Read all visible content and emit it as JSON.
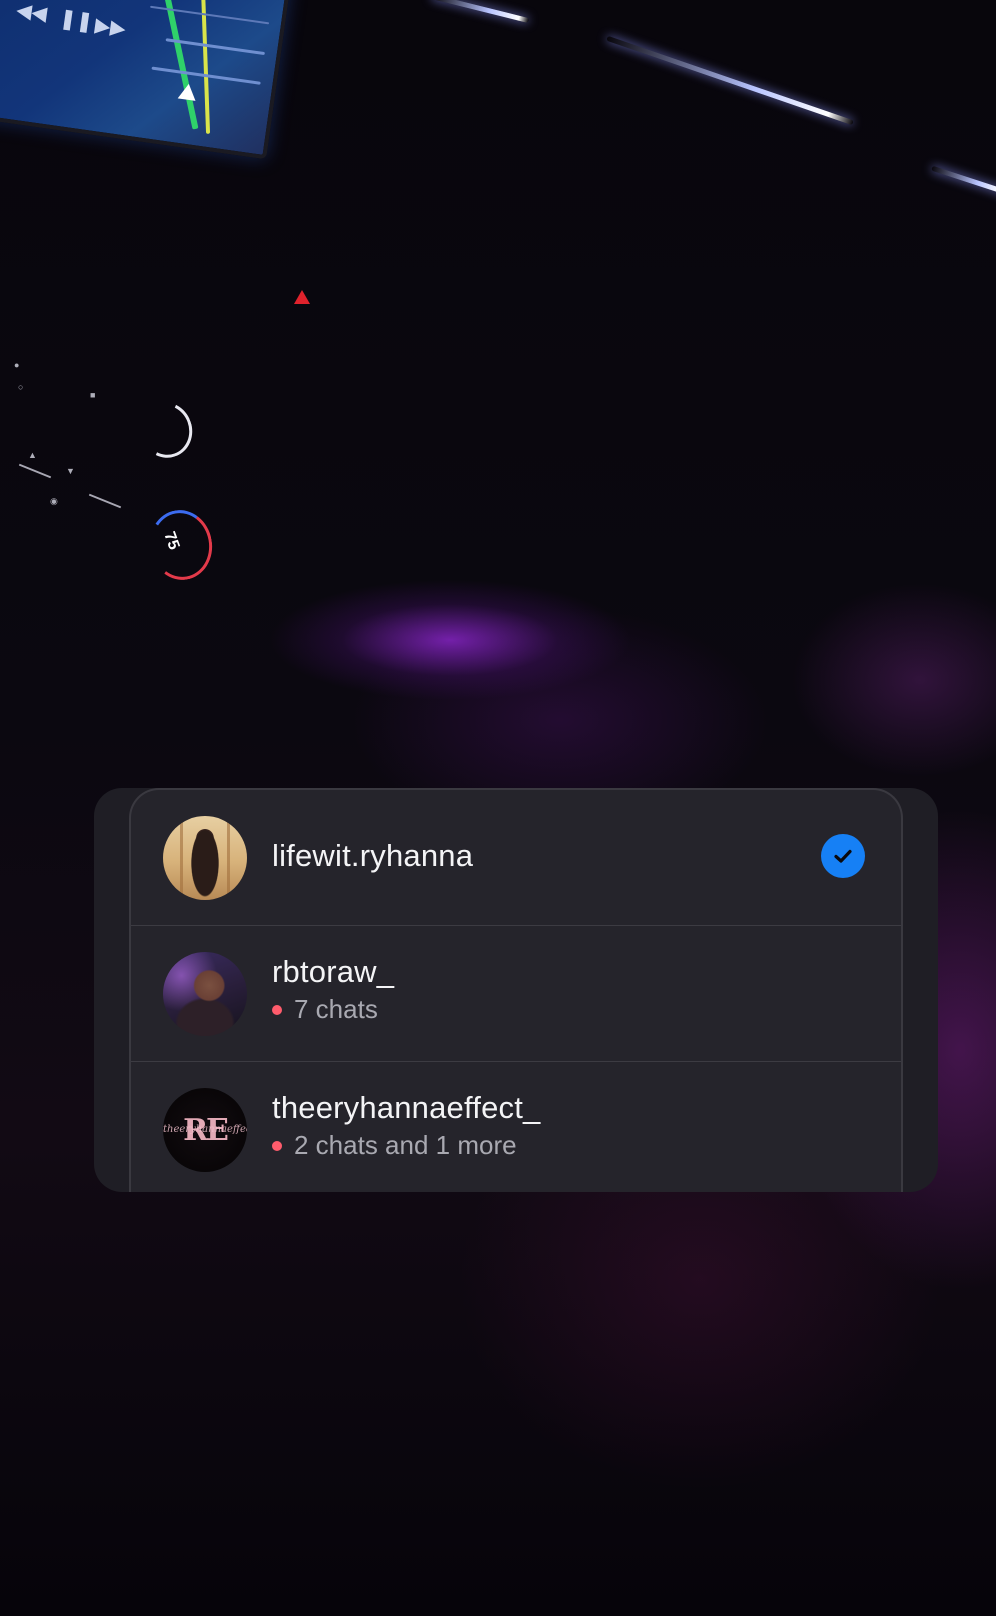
{
  "accounts": [
    {
      "username": "lifewit.ryhanna",
      "selected": true,
      "status": ""
    },
    {
      "username": "rbtoraw_",
      "selected": false,
      "status": "7 chats"
    },
    {
      "username": "theeryhannaeffect_",
      "selected": false,
      "status": "2 chats and 1 more"
    }
  ],
  "avatar3_monogram": "RE",
  "avatar3_script": "theeryhannaeffect",
  "dashboard": {
    "temperature": "75",
    "media_controls": [
      "prev-icon",
      "pause-icon",
      "next-icon"
    ]
  },
  "colors": {
    "sheet_bg": "#25242b",
    "check_blue": "#1680f5",
    "unread_dot": "#ff5c6c",
    "ambient_purple": "#9628dc"
  }
}
